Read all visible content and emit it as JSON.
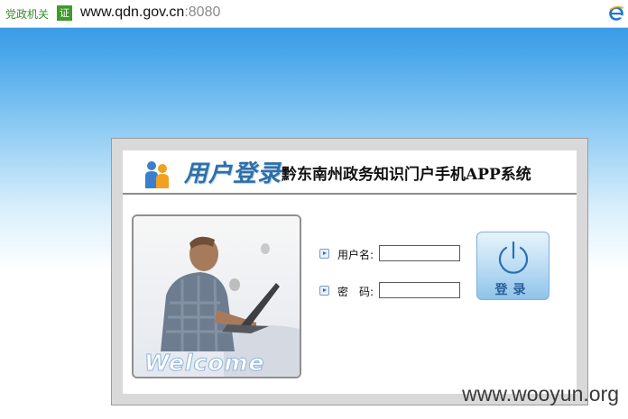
{
  "browser": {
    "cert_label": "党政机关",
    "cert_badge": "证",
    "url_host": "www.qdn.gov.cn",
    "url_port": ":8080",
    "browser_icon": "ie-icon"
  },
  "login": {
    "header_title": "用户登录",
    "system_name": "黔东南州政务知识门户手机APP系统",
    "welcome_text": "Welcome",
    "username_label": "用户名:",
    "username_value": "",
    "password_label": "密　码:",
    "password_value": "",
    "login_button": "登录"
  },
  "watermark": "www.wooyun.org",
  "colors": {
    "accent": "#2f6fa8",
    "button_top": "#e6f3fc",
    "button_bottom": "#8fc3ea",
    "background_top": "#2a90e0"
  }
}
